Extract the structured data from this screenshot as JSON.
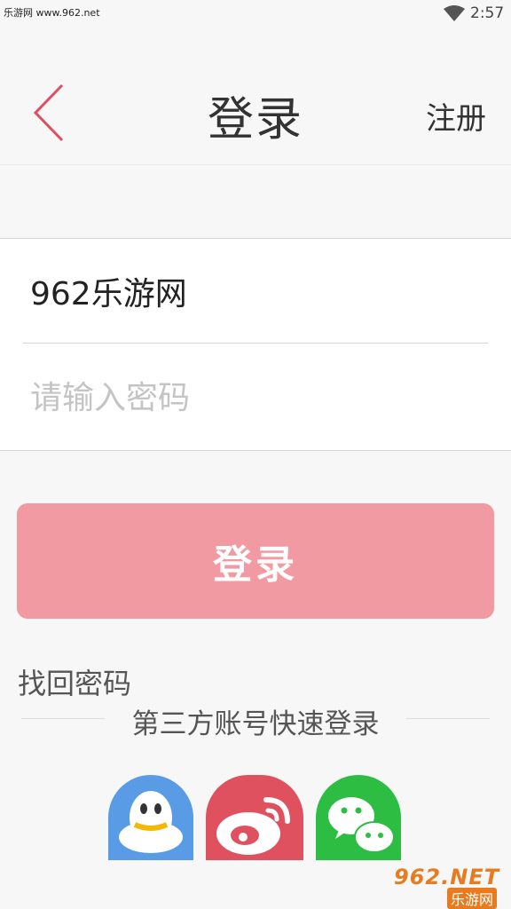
{
  "status_bar": {
    "watermark": "乐游网 www.962.net",
    "time": "2:57"
  },
  "header": {
    "title": "登录",
    "register_label": "注册"
  },
  "form": {
    "username_value": "962乐游网",
    "password_placeholder": "请输入密码"
  },
  "login_button": {
    "label": "登录"
  },
  "forgot_password": {
    "label": "找回密码"
  },
  "third_party": {
    "label": "第三方账号快速登录",
    "providers": [
      "qq-icon",
      "weibo-icon",
      "wechat-icon"
    ]
  },
  "watermark": {
    "logo_text": "962.NET",
    "sub_text": "乐游网"
  },
  "colors": {
    "accent": "#f29aa2",
    "back_arrow": "#e04e62",
    "qq": "#5a9be6",
    "weibo": "#e0515f",
    "wechat": "#2dbd43"
  }
}
